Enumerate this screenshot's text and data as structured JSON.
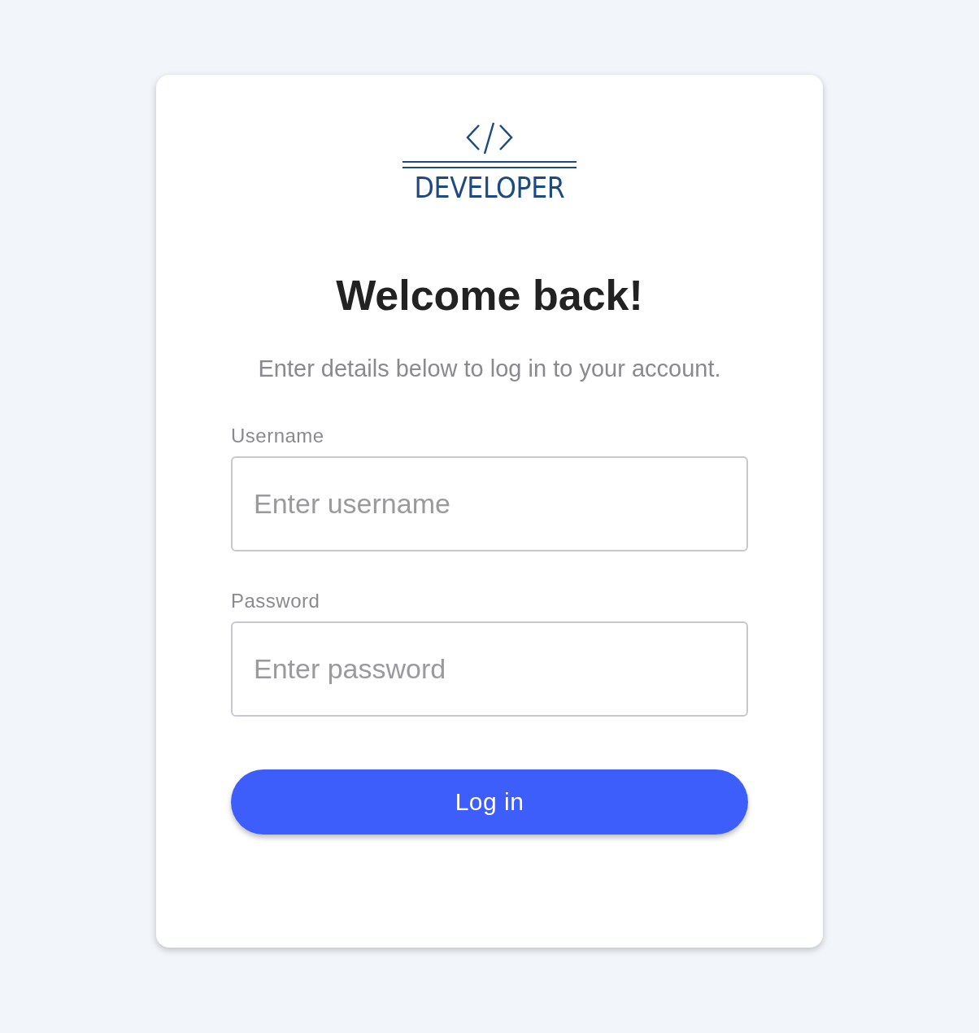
{
  "logo": {
    "text": "DEVELOPER"
  },
  "heading": "Welcome back!",
  "subtitle": "Enter details below to log in to your account.",
  "fields": [
    {
      "label": "Username",
      "placeholder": "Enter username"
    },
    {
      "label": "Password",
      "placeholder": "Enter password"
    }
  ],
  "submit": "Log in"
}
